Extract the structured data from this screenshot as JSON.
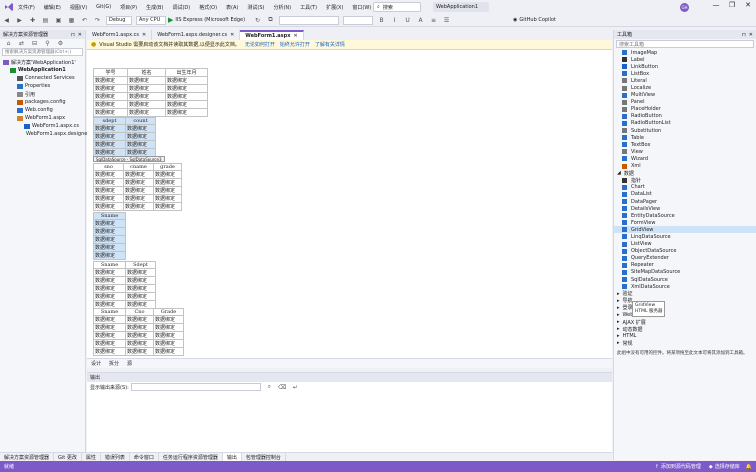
{
  "window": {
    "app_title": "WebApplication1",
    "search_label": "搜索",
    "user_initials": "GH",
    "copilot": "GitHub Copilot",
    "menu": [
      "文件(F)",
      "编辑(E)",
      "视图(V)",
      "Git(G)",
      "项目(P)",
      "生成(B)",
      "调试(D)",
      "格式(O)",
      "表(A)",
      "测试(S)",
      "分析(N)",
      "工具(T)",
      "扩展(X)",
      "窗口(W)",
      "帮助(H)"
    ],
    "minimize": "—",
    "maximize": "❐",
    "close": "✕"
  },
  "toolbar": {
    "config": "Debug",
    "platform": "Any CPU",
    "run_target": "IIS Express (Microsoft Edge)"
  },
  "solution_explorer": {
    "title": "解决方案资源管理器",
    "search_placeholder": "搜索解决方案资源管理器(Ctrl+;)",
    "items": [
      {
        "label": "解决方案'WebApplication1'",
        "indent": 0
      },
      {
        "label": "WebApplication1",
        "indent": 1
      },
      {
        "label": "Connected Services",
        "indent": 2
      },
      {
        "label": "Properties",
        "indent": 2
      },
      {
        "label": "引用",
        "indent": 2
      },
      {
        "label": "packages.config",
        "indent": 2
      },
      {
        "label": "Web.config",
        "indent": 2
      },
      {
        "label": "WebForm1.aspx",
        "indent": 2
      },
      {
        "label": "WebForm1.aspx.cs",
        "indent": 3
      },
      {
        "label": "WebForm1.aspx.designer.cs",
        "indent": 3
      }
    ]
  },
  "doc_tabs": [
    {
      "label": "WebForm1.aspx.cs",
      "active": false
    },
    {
      "label": "WebForm1.aspx.designer.cs",
      "active": false
    },
    {
      "label": "WebForm1.aspx",
      "active": true
    }
  ],
  "infobar": {
    "text": "Visual Studio 需要启动该文档并读取其数据,以便显示此文档。",
    "link1": "无论如何打开",
    "link2": "始终允许打开",
    "link3": "了解有关详情"
  },
  "designer": {
    "t1": {
      "headers": [
        "学号",
        "姓名",
        "出生年月"
      ],
      "rows": [
        [
          "数据绑定",
          "数据绑定",
          "数据绑定"
        ],
        [
          "数据绑定",
          "数据绑定",
          "数据绑定"
        ],
        [
          "数据绑定",
          "数据绑定",
          "数据绑定"
        ],
        [
          "数据绑定",
          "数据绑定",
          "数据绑定"
        ],
        [
          "数据绑定",
          "数据绑定",
          "数据绑定"
        ]
      ]
    },
    "t2": {
      "headers": [
        "sdept",
        "count"
      ],
      "rows": [
        [
          "数据绑定",
          "数据绑定"
        ],
        [
          "数据绑定",
          "数据绑定"
        ],
        [
          "数据绑定",
          "数据绑定"
        ],
        [
          "数据绑定",
          "数据绑定"
        ]
      ]
    },
    "sqlsource": "SqlDataSource - SqlDataSource3",
    "t3": {
      "headers": [
        "sno",
        "cname",
        "grade"
      ],
      "rows": [
        [
          "数据绑定",
          "数据绑定",
          "数据绑定"
        ],
        [
          "数据绑定",
          "数据绑定",
          "数据绑定"
        ],
        [
          "数据绑定",
          "数据绑定",
          "数据绑定"
        ],
        [
          "数据绑定",
          "数据绑定",
          "数据绑定"
        ],
        [
          "数据绑定",
          "数据绑定",
          "数据绑定"
        ]
      ]
    },
    "t4": {
      "headers": [
        "Sname"
      ],
      "rows": [
        [
          "数据绑定"
        ],
        [
          "数据绑定"
        ],
        [
          "数据绑定"
        ],
        [
          "数据绑定"
        ],
        [
          "数据绑定"
        ]
      ]
    },
    "t5": {
      "headers": [
        "Sname",
        "Sdept"
      ],
      "rows": [
        [
          "数据绑定",
          "数据绑定"
        ],
        [
          "数据绑定",
          "数据绑定"
        ],
        [
          "数据绑定",
          "数据绑定"
        ],
        [
          "数据绑定",
          "数据绑定"
        ],
        [
          "数据绑定",
          "数据绑定"
        ]
      ]
    },
    "t6": {
      "headers": [
        "Sname",
        "Cno",
        "Grade"
      ],
      "rows": [
        [
          "数据绑定",
          "数据绑定",
          "数据绑定"
        ],
        [
          "数据绑定",
          "数据绑定",
          "数据绑定"
        ],
        [
          "数据绑定",
          "数据绑定",
          "数据绑定"
        ],
        [
          "数据绑定",
          "数据绑定",
          "数据绑定"
        ],
        [
          "数据绑定",
          "数据绑定",
          "数据绑定"
        ]
      ]
    }
  },
  "view_tabs": [
    "设计",
    "拆分",
    "源"
  ],
  "output": {
    "title": "输出",
    "source_label": "显示输出来源(S):"
  },
  "toolbox": {
    "title": "工具箱",
    "search_placeholder": "搜索工具箱",
    "standard_items": [
      "ImageMap",
      "Label",
      "LinkButton",
      "ListBox",
      "Literal",
      "Localize",
      "MultiView",
      "Panel",
      "PlaceHolder",
      "RadioButton",
      "RadioButtonList",
      "Substitution",
      "Table",
      "TextBox",
      "View",
      "Wizard",
      "Xml"
    ],
    "data_group": "数据",
    "data_items": [
      "指针",
      "Chart",
      "DataList",
      "DataPager",
      "DetailsView",
      "EntityDataSource",
      "FormView",
      "GridView",
      "LinqDataSource",
      "ListView",
      "ObjectDataSource",
      "QueryExtender",
      "Repeater",
      "SiteMapDataSource",
      "SqlDataSource",
      "XmlDataSource"
    ],
    "selected": "GridView",
    "tooltip1": "GridView",
    "tooltip2": "HTML 服务器",
    "groups": [
      "验证",
      "导航",
      "登录",
      "WebParts",
      "AJAX 扩展",
      "动态数据",
      "HTML",
      "常规"
    ],
    "empty_hint": "此组中没有可用的控件。将某项拖至此文本可将其添加到工具箱。"
  },
  "bottom_tabs": [
    "解决方案资源管理器",
    "Git 更改",
    "属性",
    "错误列表",
    "命令窗口",
    "任务运行程序资源管理器",
    "输出",
    "包管理器控制台"
  ],
  "status": {
    "ready": "就绪",
    "add_source": "添加到源代码管理",
    "select_repo": "选择存储库"
  }
}
